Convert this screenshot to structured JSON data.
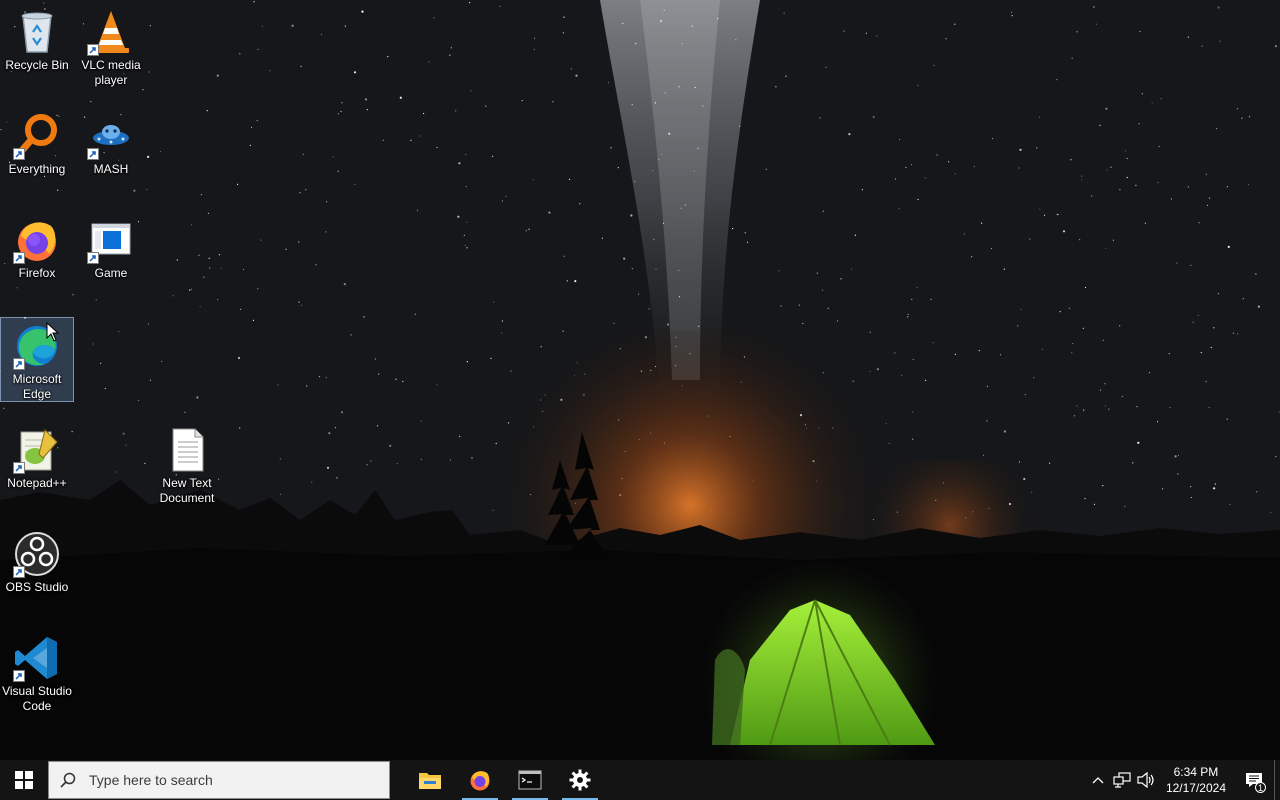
{
  "desktop": {
    "icons": [
      {
        "label": "Recycle Bin",
        "icon": "recycle-bin-icon"
      },
      {
        "label": "VLC media player",
        "icon": "vlc-icon"
      },
      {
        "label": "Everything",
        "icon": "everything-icon"
      },
      {
        "label": "MASH",
        "icon": "mash-icon"
      },
      {
        "label": "Firefox",
        "icon": "firefox-icon"
      },
      {
        "label": "Game",
        "icon": "game-icon"
      },
      {
        "label": "Microsoft Edge",
        "icon": "edge-icon"
      },
      {
        "label": "Notepad++",
        "icon": "notepadpp-icon"
      },
      {
        "label": "New Text Document",
        "icon": "text-document-icon"
      },
      {
        "label": "OBS Studio",
        "icon": "obs-icon"
      },
      {
        "label": "Visual Studio Code",
        "icon": "vscode-icon"
      }
    ]
  },
  "taskbar": {
    "search": {
      "placeholder": "Type here to search"
    },
    "apps": [
      {
        "name": "File Explorer",
        "icon": "file-explorer-icon"
      },
      {
        "name": "Firefox",
        "icon": "firefox-icon"
      },
      {
        "name": "Terminal",
        "icon": "terminal-icon"
      },
      {
        "name": "Settings",
        "icon": "gear-icon"
      }
    ],
    "clock": {
      "time": "6:34 PM",
      "date": "12/17/2024"
    },
    "notifications": {
      "count": "1"
    }
  },
  "colors": {
    "taskbar": "#141414",
    "accent": "#76b9ed"
  }
}
